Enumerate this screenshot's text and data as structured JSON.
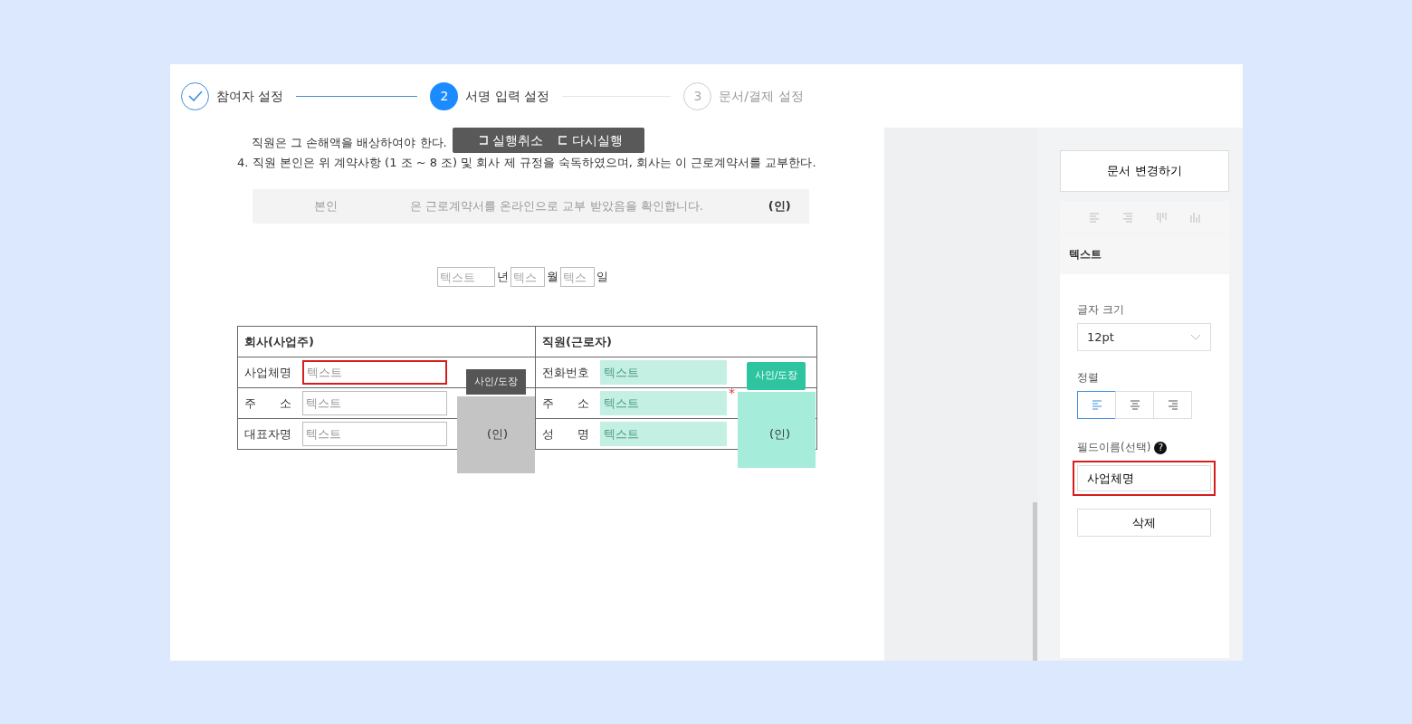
{
  "stepper": [
    {
      "label": "참여자 설정",
      "done": true,
      "selected": false
    },
    {
      "number": "2",
      "label": "서명 입력 설정",
      "done": false,
      "selected": true
    },
    {
      "number": "3",
      "label": "문서/결제 설정",
      "done": false,
      "selected": false
    }
  ],
  "edit_toolbar": [
    {
      "kind": "undo",
      "label": "실행취소"
    },
    {
      "kind": "redo",
      "label": "다시실행"
    }
  ],
  "document": {
    "paragraphs": [
      "직원은 그 손해액을 배상하여야 한다.",
      "4. 직원 본인은 위 계약사항 (1 조 ~ 8 조) 및 회사 제 규정을 숙독하였으며, 회사는 이 근로계약서를 교부한다."
    ],
    "confirm_box": {
      "name": "본인",
      "sentence": "은 근로계약서를 온라인으로 교부 받았음을 확인합니다.",
      "seal": "(인)"
    },
    "date_fields": [
      {
        "placeholder": "텍스트",
        "unit": "년"
      },
      {
        "placeholder": "텍스",
        "unit": "월"
      },
      {
        "placeholder": "텍스",
        "unit": "일"
      }
    ],
    "table": {
      "columns": [
        {
          "heading": "회사(사업주)",
          "kind": "plain",
          "signature": {
            "label": "사인/도장"
          },
          "rows": [
            {
              "label": "사업체명",
              "placeholder": "텍스트",
              "selected": true
            },
            {
              "label": "주 소",
              "placeholder": "텍스트",
              "selected": false
            },
            {
              "label": "대표자명",
              "placeholder": "텍스트",
              "selected": false,
              "seal": "(인)"
            }
          ]
        },
        {
          "heading": "직원(근로자)",
          "kind": "highlighted",
          "signature": {
            "label": "사인/도장",
            "required_mark": "*"
          },
          "rows": [
            {
              "label": "전화번호",
              "placeholder": "텍스트",
              "selected": false
            },
            {
              "label": "주 소",
              "placeholder": "텍스트",
              "selected": false
            },
            {
              "label": "성 명",
              "placeholder": "텍스트",
              "selected": false,
              "seal": "(인)"
            }
          ]
        }
      ]
    }
  },
  "panel": {
    "change_button": "문서 변경하기",
    "section_title": "텍스트",
    "font_size": {
      "label": "글자 크기",
      "value": "12pt"
    },
    "align": {
      "label": "정렬",
      "options": [
        {
          "kind": "left",
          "selected": true
        },
        {
          "kind": "center",
          "selected": false
        },
        {
          "kind": "right",
          "selected": false
        }
      ]
    },
    "field_name": {
      "label": "필드이름(선택)",
      "help_icon": "?",
      "value": "사업체명",
      "highlighted": true
    },
    "delete_button": "삭제"
  }
}
